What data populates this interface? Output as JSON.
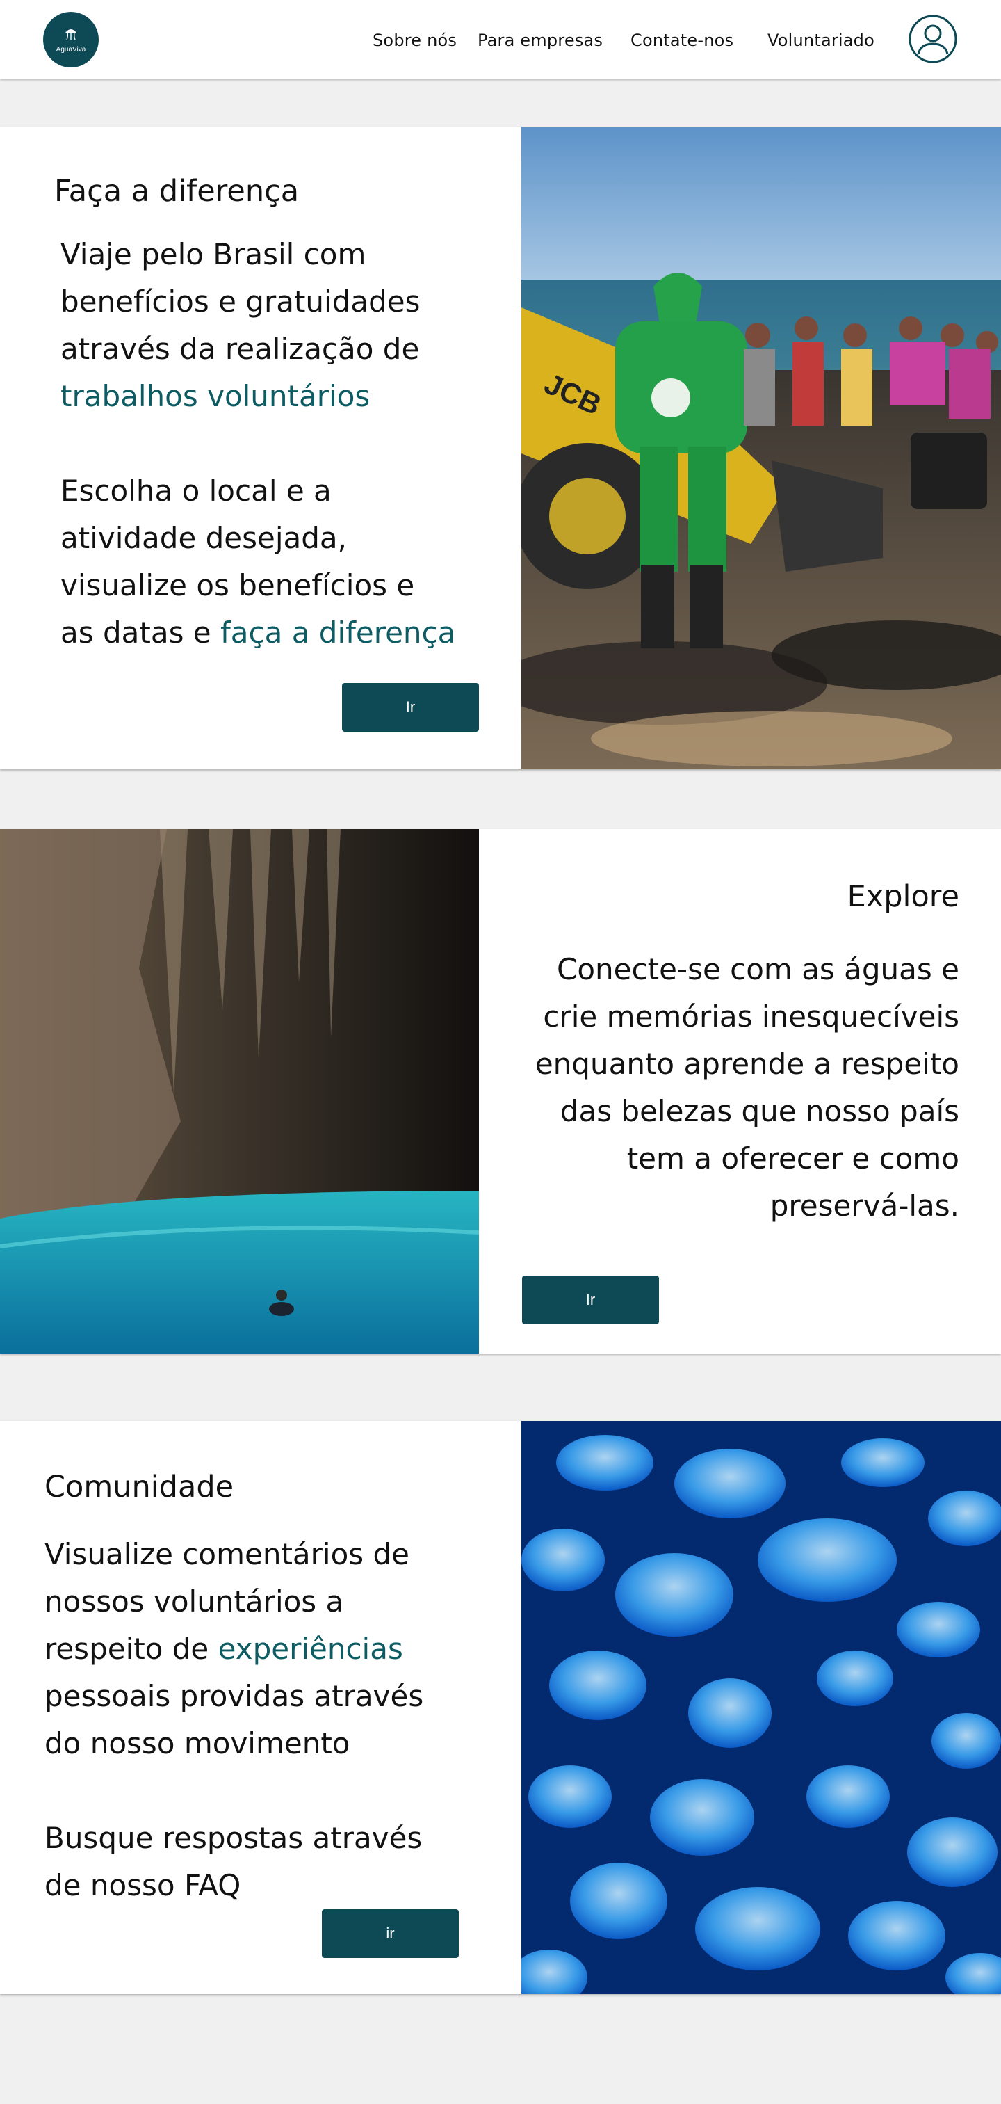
{
  "header": {
    "logo_text": "AguaViva",
    "nav": [
      "Sobre nós",
      "Para empresas",
      "Contate-nos",
      "Voluntariado"
    ]
  },
  "sections": [
    {
      "title": "Faça a diferença",
      "para1": "Viaje pelo Brasil com benefícios e gratuidades através da realização de ",
      "para1_highlight": "trabalhos voluntários",
      "para2": "Escolha o local e a atividade desejada, visualize os benefícios e as datas e ",
      "para2_highlight": "faça a diferença",
      "button": "Ir"
    },
    {
      "title": "Explore",
      "para1": "Conecte-se com as águas e crie  memórias inesquecíveis enquanto aprende a respeito das belezas que nosso país tem a oferecer e como preservá-las.",
      "button": "Ir"
    },
    {
      "title": "Comunidade",
      "para1_pre": "Visualize comentários de nossos voluntários a respeito de ",
      "para1_highlight": "experiências",
      "para1_post": " pessoais providas através do nosso movimento",
      "para2": "Busque respostas através de nosso FAQ",
      "button": "ir"
    }
  ],
  "colors": {
    "accent": "#0d4a55",
    "highlight": "#0d5c63",
    "background": "#f0f0f0"
  }
}
